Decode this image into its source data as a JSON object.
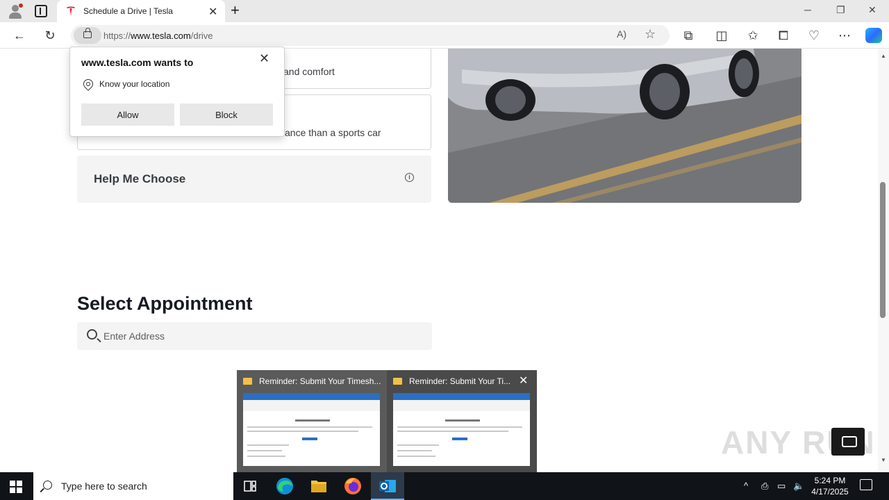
{
  "browser": {
    "tab_title": "Schedule a Drive | Tesla",
    "url_prefix": "https://",
    "url_host": "www.tesla.com",
    "url_path": "/drive"
  },
  "page": {
    "card1_desc": "and comfort",
    "card2_desc": "ance than a sports car",
    "help_label": "Help Me Choose",
    "section_title": "Select Appointment",
    "address_placeholder": "Enter Address"
  },
  "permission": {
    "title": "www.tesla.com wants to",
    "item": "Know your location",
    "allow_label": "Allow",
    "block_label": "Block"
  },
  "thumbnails": [
    {
      "title": "Reminder: Submit Your Timesh..."
    },
    {
      "title": "Reminder: Submit Your Ti..."
    }
  ],
  "taskbar": {
    "search_placeholder": "Type here to search",
    "time": "5:24 PM",
    "date": "4/17/2025"
  },
  "watermark": "ANY RUN",
  "colors": {
    "tesla_red": "#e31937",
    "taskbar_bg": "#101418",
    "accent_blue": "#2b6fc4"
  }
}
